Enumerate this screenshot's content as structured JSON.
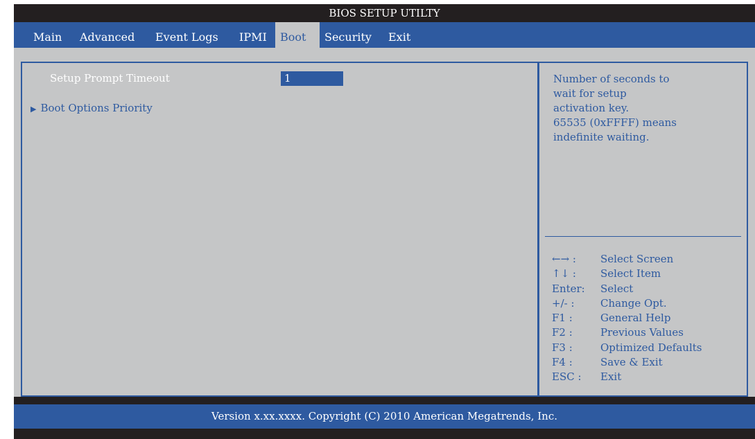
{
  "title": "BIOS SETUP UTILTY",
  "tabs": [
    {
      "label": "Main"
    },
    {
      "label": "Advanced"
    },
    {
      "label": "Event Logs"
    },
    {
      "label": "IPMI"
    },
    {
      "label": "Boot"
    },
    {
      "label": "Security"
    },
    {
      "label": "Exit"
    }
  ],
  "active_tab": "Boot",
  "items": {
    "setup_prompt_label": "Setup Prompt Timeout",
    "setup_prompt_value": "1",
    "boot_options_arrow": "▶",
    "boot_options_label": "Boot Options Priority"
  },
  "help": {
    "lines": [
      "Number of seconds to",
      "wait for setup",
      "activation key.",
      "65535 (0xFFFF) means",
      "indefinite waiting."
    ]
  },
  "keys": [
    {
      "key": "←→ :",
      "desc": "Select Screen"
    },
    {
      "key": "↑↓  :",
      "desc": "Select Item"
    },
    {
      "key": "Enter:",
      "desc": "Select"
    },
    {
      "key": "+/- :",
      "desc": "Change Opt."
    },
    {
      "key": "F1 :",
      "desc": "General Help"
    },
    {
      "key": "F2 :",
      "desc": "Previous Values"
    },
    {
      "key": "F3 :",
      "desc": "Optimized Defaults"
    },
    {
      "key": "F4 :",
      "desc": "Save & Exit"
    },
    {
      "key": "ESC :",
      "desc": "Exit"
    }
  ],
  "footer": "Version x.xx.xxxx. Copyright (C) 2010 American Megatrends, Inc.",
  "colors": {
    "accent_blue": "#2e5aa0",
    "panel_gray": "#c5c6c7",
    "frame_dark": "#231f20"
  }
}
